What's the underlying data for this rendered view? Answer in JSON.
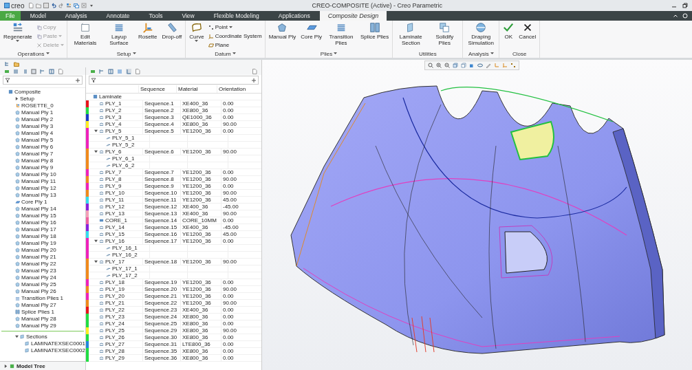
{
  "title_bar": {
    "logo": "creo",
    "title": "CREO-COMPOSITE (Active) - Creo Parametric"
  },
  "tabs": [
    {
      "label": "File",
      "selected": false,
      "kind": "file"
    },
    {
      "label": "Model",
      "selected": false,
      "kind": "tab"
    },
    {
      "label": "Analysis",
      "selected": false,
      "kind": "tab"
    },
    {
      "label": "Annotate",
      "selected": false,
      "kind": "tab"
    },
    {
      "label": "Tools",
      "selected": false,
      "kind": "tab"
    },
    {
      "label": "View",
      "selected": false,
      "kind": "tab"
    },
    {
      "label": "Flexible Modeling",
      "selected": false,
      "kind": "tab"
    },
    {
      "label": "Applications",
      "selected": false,
      "kind": "tab"
    },
    {
      "label": "Composite Design",
      "selected": true,
      "kind": "tab"
    }
  ],
  "ribbon": {
    "groups": [
      {
        "label": "Operations",
        "has_menu": true,
        "tools": [
          {
            "label": "Regenerate",
            "kind": "large",
            "has_menu": true,
            "disabled": false
          },
          {
            "label": "Copy",
            "kind": "small",
            "has_menu": false,
            "disabled": true
          },
          {
            "label": "Paste",
            "kind": "small",
            "has_menu": true,
            "disabled": true
          },
          {
            "label": "Delete",
            "kind": "small",
            "has_menu": true,
            "disabled": true
          }
        ]
      },
      {
        "label": "Setup",
        "has_menu": true,
        "tools": [
          {
            "label": "Edit Materials",
            "kind": "large",
            "has_menu": false,
            "disabled": false
          },
          {
            "label": "Layup Surface",
            "kind": "large",
            "has_menu": false,
            "disabled": false
          },
          {
            "label": "Rosette",
            "kind": "large",
            "has_menu": false,
            "disabled": false
          },
          {
            "label": "Drop-off",
            "kind": "large",
            "has_menu": false,
            "disabled": false
          }
        ]
      },
      {
        "label": "Datum",
        "has_menu": true,
        "tools": [
          {
            "label": "Curve",
            "kind": "large",
            "has_menu": true,
            "disabled": false
          },
          {
            "label": "Point",
            "kind": "small",
            "has_menu": true,
            "disabled": false
          },
          {
            "label": "Coordinate System",
            "kind": "small",
            "has_menu": false,
            "disabled": false
          },
          {
            "label": "Plane",
            "kind": "small",
            "has_menu": false,
            "disabled": false
          }
        ]
      },
      {
        "label": "Plies",
        "has_menu": true,
        "tools": [
          {
            "label": "Manual Ply",
            "kind": "large",
            "has_menu": false,
            "disabled": false
          },
          {
            "label": "Core Ply",
            "kind": "large",
            "has_menu": false,
            "disabled": false
          },
          {
            "label": "Transition Plies",
            "kind": "large",
            "has_menu": false,
            "disabled": false
          },
          {
            "label": "Splice Plies",
            "kind": "large",
            "has_menu": false,
            "disabled": false
          }
        ]
      },
      {
        "label": "Utilities",
        "has_menu": false,
        "tools": [
          {
            "label": "Laminate Section",
            "kind": "large",
            "has_menu": false,
            "disabled": false
          },
          {
            "label": "Solidify Plies",
            "kind": "large",
            "has_menu": false,
            "disabled": false
          }
        ]
      },
      {
        "label": "Analysis",
        "has_menu": true,
        "tools": [
          {
            "label": "Draping Simulation",
            "kind": "large",
            "has_menu": false,
            "disabled": false
          }
        ]
      },
      {
        "label": "Close",
        "has_menu": false,
        "tools": [
          {
            "label": "OK",
            "kind": "large",
            "has_menu": false,
            "disabled": false
          },
          {
            "label": "Cancel",
            "kind": "large",
            "has_menu": false,
            "disabled": false
          }
        ]
      }
    ]
  },
  "model_tree": {
    "items": [
      {
        "label": "Composite",
        "kind": "assembly",
        "children": [
          {
            "label": "Setup",
            "kind": "setup",
            "expanded": false
          },
          {
            "label": "ROSETTE_0",
            "kind": "rosette"
          },
          {
            "label": "Manual Ply 1",
            "kind": "ply"
          },
          {
            "label": "Manual Ply 2",
            "kind": "ply"
          },
          {
            "label": "Manual Ply 3",
            "kind": "ply"
          },
          {
            "label": "Manual Ply 4",
            "kind": "ply"
          },
          {
            "label": "Manual Ply 5",
            "kind": "ply"
          },
          {
            "label": "Manual Ply 6",
            "kind": "ply"
          },
          {
            "label": "Manual Ply 7",
            "kind": "ply"
          },
          {
            "label": "Manual Ply 8",
            "kind": "ply"
          },
          {
            "label": "Manual Ply 9",
            "kind": "ply"
          },
          {
            "label": "Manual Ply 10",
            "kind": "ply"
          },
          {
            "label": "Manual Ply 11",
            "kind": "ply"
          },
          {
            "label": "Manual Ply 12",
            "kind": "ply"
          },
          {
            "label": "Manual Ply 13",
            "kind": "ply"
          },
          {
            "label": "Core Ply 1",
            "kind": "core"
          },
          {
            "label": "Manual Ply 14",
            "kind": "ply"
          },
          {
            "label": "Manual Ply 15",
            "kind": "ply"
          },
          {
            "label": "Manual Ply 16",
            "kind": "ply"
          },
          {
            "label": "Manual Ply 17",
            "kind": "ply"
          },
          {
            "label": "Manual Ply 18",
            "kind": "ply"
          },
          {
            "label": "Manual Ply 19",
            "kind": "ply"
          },
          {
            "label": "Manual Ply 20",
            "kind": "ply"
          },
          {
            "label": "Manual Ply 21",
            "kind": "ply"
          },
          {
            "label": "Manual Ply 22",
            "kind": "ply"
          },
          {
            "label": "Manual Ply 23",
            "kind": "ply"
          },
          {
            "label": "Manual Ply 24",
            "kind": "ply"
          },
          {
            "label": "Manual Ply 25",
            "kind": "ply"
          },
          {
            "label": "Manual Ply 26",
            "kind": "ply"
          },
          {
            "label": "Transition Plies 1",
            "kind": "transition"
          },
          {
            "label": "Manual Ply 27",
            "kind": "ply"
          },
          {
            "label": "Splice Plies 1",
            "kind": "splice"
          },
          {
            "label": "Manual Ply 28",
            "kind": "ply"
          },
          {
            "label": "Manual Ply 29",
            "kind": "ply"
          }
        ]
      }
    ],
    "sections": {
      "label": "Sections",
      "expanded": true,
      "children": [
        {
          "label": "LAMINATEXSEC0001"
        },
        {
          "label": "LAMINATEXSEC0002"
        }
      ]
    },
    "footer": "Model Tree"
  },
  "laminate_table": {
    "columns": [
      "Sequence",
      "Material",
      "Orientation"
    ],
    "root": "Laminate",
    "rows": [
      {
        "name": "PLY_1",
        "kind": "ply",
        "sequence": "Sequence.1",
        "material": "XE400_36",
        "orientation": "0.00",
        "color": "#e8141c"
      },
      {
        "name": "PLY_2",
        "kind": "ply",
        "sequence": "Sequence.2",
        "material": "XE800_36",
        "orientation": "0.00",
        "color": "#22dd44"
      },
      {
        "name": "PLY_3",
        "kind": "ply",
        "sequence": "Sequence.3",
        "material": "QE1000_36",
        "orientation": "0.00",
        "color": "#1c3cc8"
      },
      {
        "name": "PLY_4",
        "kind": "ply",
        "sequence": "Sequence.4",
        "material": "XE800_36",
        "orientation": "90.00",
        "color": "#ffee22"
      },
      {
        "name": "PLY_5",
        "kind": "ply",
        "sequence": "Sequence.5",
        "material": "YE1200_36",
        "orientation": "0.00",
        "color": "#ee22bb",
        "expanded": true,
        "children": [
          {
            "name": "PLY_5_1",
            "color": "#ee22bb"
          },
          {
            "name": "PLY_5_2",
            "color": "#ee22bb"
          }
        ]
      },
      {
        "name": "PLY_6",
        "kind": "ply",
        "sequence": "Sequence.6",
        "material": "YE1200_36",
        "orientation": "90.00",
        "color": "#f08a1c",
        "expanded": true,
        "children": [
          {
            "name": "PLY_6_1",
            "color": "#f08a1c"
          },
          {
            "name": "PLY_6_2",
            "color": "#f08a1c"
          }
        ]
      },
      {
        "name": "PLY_7",
        "kind": "ply",
        "sequence": "Sequence.7",
        "material": "YE1200_36",
        "orientation": "0.00",
        "color": "#ee22bb"
      },
      {
        "name": "PLY_8",
        "kind": "ply",
        "sequence": "Sequence.8",
        "material": "YE1200_36",
        "orientation": "90.00",
        "color": "#f08a1c"
      },
      {
        "name": "PLY_9",
        "kind": "ply",
        "sequence": "Sequence.9",
        "material": "YE1200_36",
        "orientation": "0.00",
        "color": "#ee22bb"
      },
      {
        "name": "PLY_10",
        "kind": "ply",
        "sequence": "Sequence.10",
        "material": "YE1200_36",
        "orientation": "90.00",
        "color": "#f08a1c"
      },
      {
        "name": "PLY_11",
        "kind": "ply",
        "sequence": "Sequence.11",
        "material": "YE1200_36",
        "orientation": "45.00",
        "color": "#33ddee"
      },
      {
        "name": "PLY_12",
        "kind": "ply",
        "sequence": "Sequence.12",
        "material": "XE400_36",
        "orientation": "-45.00",
        "color": "#8822dd"
      },
      {
        "name": "PLY_13",
        "kind": "ply",
        "sequence": "Sequence.13",
        "material": "XE400_36",
        "orientation": "90.00",
        "color": "#f4a0b8"
      },
      {
        "name": "CORE_1",
        "kind": "core",
        "sequence": "Sequence.14",
        "material": "CORE_10MM",
        "orientation": "0.00",
        "color": "#f060a0"
      },
      {
        "name": "PLY_14",
        "kind": "ply",
        "sequence": "Sequence.15",
        "material": "XE400_36",
        "orientation": "-45.00",
        "color": "#8822dd"
      },
      {
        "name": "PLY_15",
        "kind": "ply",
        "sequence": "Sequence.16",
        "material": "YE1200_36",
        "orientation": "45.00",
        "color": "#33ddee"
      },
      {
        "name": "PLY_16",
        "kind": "ply",
        "sequence": "Sequence.17",
        "material": "YE1200_36",
        "orientation": "0.00",
        "color": "#ee22bb",
        "expanded": true,
        "children": [
          {
            "name": "PLY_16_1",
            "color": "#ee22bb"
          },
          {
            "name": "PLY_16_2",
            "color": "#ee22bb"
          }
        ]
      },
      {
        "name": "PLY_17",
        "kind": "ply",
        "sequence": "Sequence.18",
        "material": "YE1200_36",
        "orientation": "90.00",
        "color": "#f08a1c",
        "expanded": true,
        "children": [
          {
            "name": "PLY_17_1",
            "color": "#f08a1c"
          },
          {
            "name": "PLY_17_2",
            "color": "#f08a1c"
          }
        ]
      },
      {
        "name": "PLY_18",
        "kind": "ply",
        "sequence": "Sequence.19",
        "material": "YE1200_36",
        "orientation": "0.00",
        "color": "#ee22bb"
      },
      {
        "name": "PLY_19",
        "kind": "ply",
        "sequence": "Sequence.20",
        "material": "YE1200_36",
        "orientation": "90.00",
        "color": "#f08a1c"
      },
      {
        "name": "PLY_20",
        "kind": "ply",
        "sequence": "Sequence.21",
        "material": "YE1200_36",
        "orientation": "0.00",
        "color": "#ee22bb"
      },
      {
        "name": "PLY_21",
        "kind": "ply",
        "sequence": "Sequence.22",
        "material": "YE1200_36",
        "orientation": "90.00",
        "color": "#f08a1c"
      },
      {
        "name": "PLY_22",
        "kind": "ply",
        "sequence": "Sequence.23",
        "material": "XE400_36",
        "orientation": "0.00",
        "color": "#e8141c"
      },
      {
        "name": "PLY_23",
        "kind": "ply",
        "sequence": "Sequence.24",
        "material": "XE800_36",
        "orientation": "0.00",
        "color": "#22dd44"
      },
      {
        "name": "PLY_24",
        "kind": "ply",
        "sequence": "Sequence.25",
        "material": "XE800_36",
        "orientation": "0.00",
        "color": "#22dd44"
      },
      {
        "name": "PLY_25",
        "kind": "ply",
        "sequence": "Sequence.29",
        "material": "XE800_36",
        "orientation": "90.00",
        "color": "#ffee22"
      },
      {
        "name": "PLY_26",
        "kind": "ply",
        "sequence": "Sequence.30",
        "material": "XE800_36",
        "orientation": "0.00",
        "color": "#22dd44"
      },
      {
        "name": "PLY_27",
        "kind": "ply",
        "sequence": "Sequence.31",
        "material": "LTE800_36",
        "orientation": "0.00",
        "color": "#2288dd"
      },
      {
        "name": "PLY_28",
        "kind": "ply",
        "sequence": "Sequence.35",
        "material": "XE800_36",
        "orientation": "0.00",
        "color": "#22dd44"
      },
      {
        "name": "PLY_29",
        "kind": "ply",
        "sequence": "Sequence.36",
        "material": "XE800_36",
        "orientation": "0.00",
        "color": "#22dd44"
      }
    ]
  }
}
